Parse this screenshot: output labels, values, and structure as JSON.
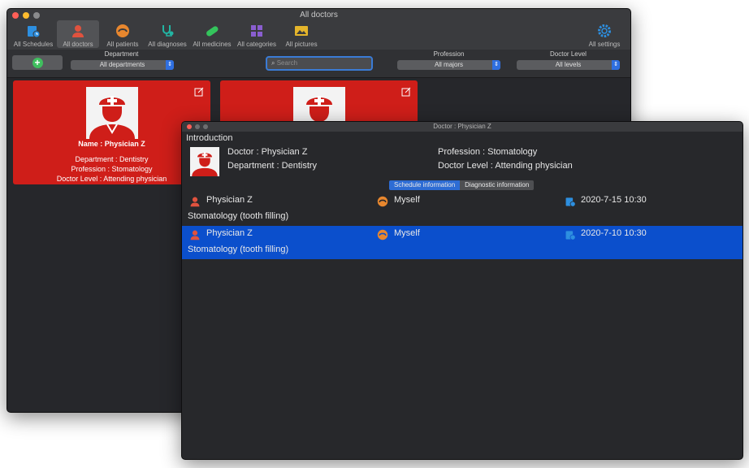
{
  "main_window": {
    "title": "All doctors",
    "toolbar": [
      {
        "label": "All Schedules",
        "icon": "schedule-icon",
        "color": "#2d8fe0"
      },
      {
        "label": "All doctors",
        "icon": "doctor-icon",
        "color": "#e0523e"
      },
      {
        "label": "All patients",
        "icon": "patient-icon",
        "color": "#e8872e"
      },
      {
        "label": "All diagnoses",
        "icon": "stethoscope-icon",
        "color": "#22b5a3"
      },
      {
        "label": "All medicines",
        "icon": "pill-icon",
        "color": "#34c45c"
      },
      {
        "label": "All categories",
        "icon": "category-icon",
        "color": "#8a5ed0"
      },
      {
        "label": "All pictures",
        "icon": "picture-icon",
        "color": "#e5b52b"
      }
    ],
    "settings_label": "All settings",
    "filters": {
      "department": {
        "label": "Department",
        "value": "All departments"
      },
      "search": {
        "placeholder": "Search"
      },
      "profession": {
        "label": "Profession",
        "value": "All majors"
      },
      "level": {
        "label": "Doctor Level",
        "value": "All levels"
      }
    },
    "cards": [
      {
        "name": "Name : Physician Z",
        "department": "Department : Dentistry",
        "profession": "Profession : Stomatology",
        "level": "Doctor Level : Attending physician"
      }
    ]
  },
  "detail_window": {
    "title": "Doctor : Physician Z",
    "intro_label": "Introduction",
    "doctor": "Doctor : Physician Z",
    "department": "Department : Dentistry",
    "profession": "Profession : Stomatology",
    "level": "Doctor Level : Attending physician",
    "tabs": {
      "schedule": "Schedule information",
      "diagnostic": "Diagnostic information"
    },
    "schedules": [
      {
        "doctor": "Physician Z",
        "patient": "Myself",
        "time": "2020-7-15 10:30",
        "desc": "Stomatology (tooth filling)",
        "selected": false
      },
      {
        "doctor": "Physician Z",
        "patient": "Myself",
        "time": "2020-7-10 10:30",
        "desc": "Stomatology (tooth filling)",
        "selected": true
      }
    ]
  },
  "colors": {
    "accent": "#2d6cd4",
    "card": "#cf1e19",
    "selected_row": "#0b4fcc"
  }
}
